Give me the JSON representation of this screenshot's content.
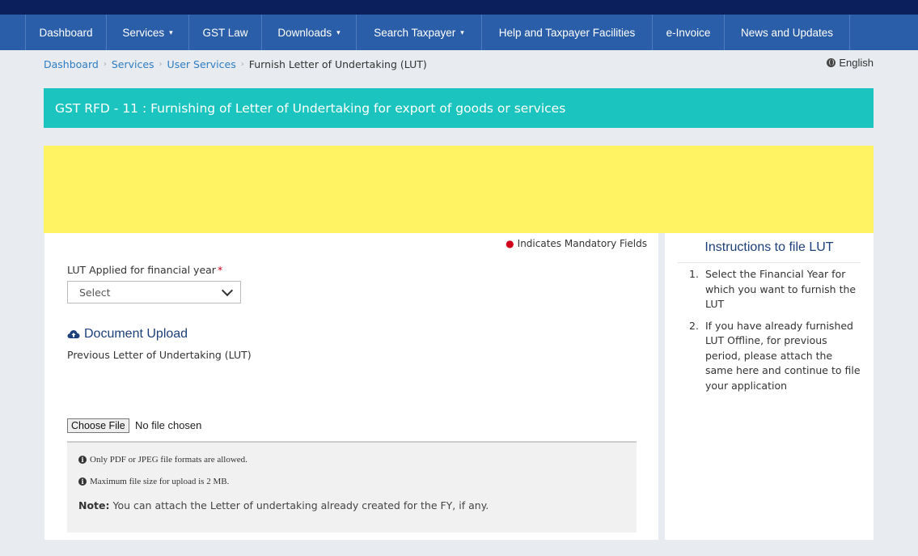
{
  "nav": {
    "items": [
      {
        "label": "Dashboard",
        "caret": false
      },
      {
        "label": "Services",
        "caret": true
      },
      {
        "label": "GST Law",
        "caret": false
      },
      {
        "label": "Downloads",
        "caret": true
      },
      {
        "label": "Search Taxpayer",
        "caret": true
      },
      {
        "label": "Help and Taxpayer Facilities",
        "caret": false
      },
      {
        "label": "e-Invoice",
        "caret": false
      },
      {
        "label": "News and Updates",
        "caret": false
      }
    ]
  },
  "breadcrumb": {
    "items": [
      "Dashboard",
      "Services",
      "User Services"
    ],
    "current": "Furnish Letter of Undertaking (LUT)"
  },
  "language": "English",
  "page_title": "GST RFD - 11 : Furnishing of Letter of Undertaking for export of goods or services",
  "form": {
    "mandatory_text": "Indicates Mandatory Fields",
    "fy_label": "LUT Applied for financial year",
    "fy_select_value": "Select",
    "doc_upload_heading": "Document Upload",
    "doc_upload_sub": "Previous Letter of Undertaking (LUT)",
    "choose_file_label": "Choose File",
    "file_status": "No file chosen",
    "info_formats": "Only PDF or JPEG file formats are allowed.",
    "info_size": "Maximum file size for upload is 2 MB.",
    "note_label": "Note:",
    "note_text": "You can attach the Letter of undertaking already created for the FY, if any."
  },
  "instructions": {
    "title": "Instructions to file LUT",
    "items": [
      {
        "num": "1.",
        "text": "Select the Financial Year for which you want to furnish the LUT"
      },
      {
        "num": "2.",
        "text": "If you have already furnished LUT Offline, for previous period, please attach the same here and continue to file your application"
      }
    ]
  },
  "colors": {
    "nav": "#2a5ea8",
    "top_strip": "#0b1f5c",
    "title_bar": "#1bc4bf",
    "banner": "#fff263",
    "mandatory_dot": "#d0021b"
  }
}
